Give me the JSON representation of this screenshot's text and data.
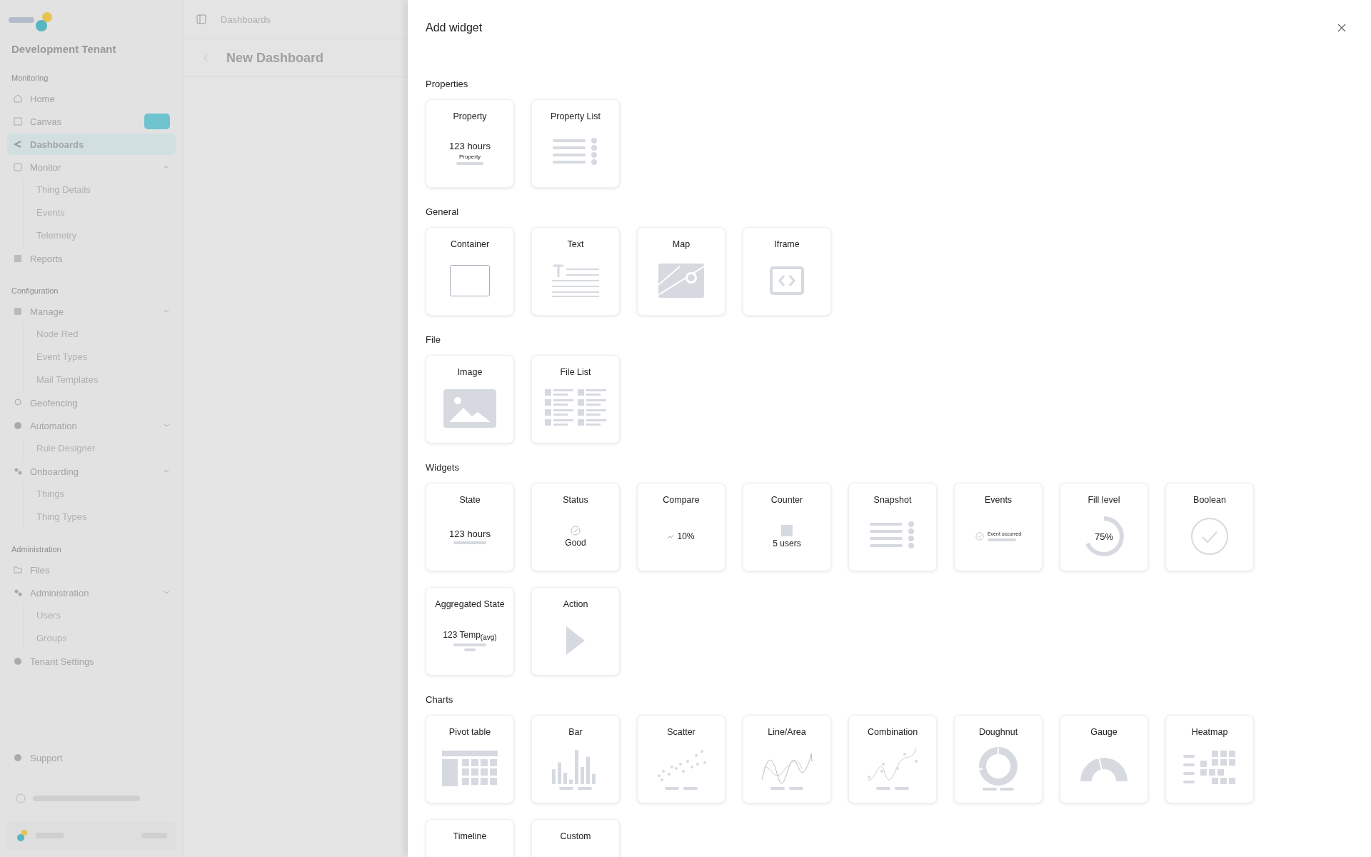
{
  "sidebar": {
    "tenant": "Development Tenant",
    "sections": [
      {
        "title": "Monitoring",
        "items": [
          {
            "label": "Home",
            "selected": false
          },
          {
            "label": "Canvas",
            "selected": false,
            "badge": true
          },
          {
            "label": "Dashboards",
            "selected": true
          },
          {
            "label": "Monitor",
            "selected": false,
            "expanded": true,
            "children": [
              {
                "label": "Thing Details"
              },
              {
                "label": "Events"
              },
              {
                "label": "Telemetry"
              }
            ]
          },
          {
            "label": "Reports",
            "selected": false
          }
        ]
      },
      {
        "title": "Configuration",
        "items": [
          {
            "label": "Manage",
            "selected": false,
            "expanded": true,
            "children": [
              {
                "label": "Node Red"
              },
              {
                "label": "Event Types"
              },
              {
                "label": "Mail Templates"
              }
            ]
          },
          {
            "label": "Geofencing",
            "selected": false
          },
          {
            "label": "Automation",
            "selected": false,
            "expanded": true,
            "children": [
              {
                "label": "Rule Designer"
              }
            ]
          },
          {
            "label": "Onboarding",
            "selected": false,
            "expanded": true,
            "children": [
              {
                "label": "Things"
              },
              {
                "label": "Thing Types"
              }
            ]
          }
        ]
      },
      {
        "title": "Administration",
        "items": [
          {
            "label": "Files",
            "selected": false
          },
          {
            "label": "Administration",
            "selected": false,
            "expanded": true,
            "children": [
              {
                "label": "Users"
              },
              {
                "label": "Groups"
              }
            ]
          },
          {
            "label": "Tenant Settings",
            "selected": false
          }
        ]
      }
    ],
    "support": "Support"
  },
  "topbar": {
    "breadcrumb": "Dashboards",
    "title": "New Dashboard"
  },
  "dialog": {
    "title": "Add widget",
    "sections": [
      {
        "title": "Properties",
        "items": [
          {
            "label": "Property",
            "kind": "property",
            "value": "123 hours",
            "caption": "Property"
          },
          {
            "label": "Property List",
            "kind": "list"
          }
        ]
      },
      {
        "title": "General",
        "items": [
          {
            "label": "Container",
            "kind": "container"
          },
          {
            "label": "Text",
            "kind": "text"
          },
          {
            "label": "Map",
            "kind": "map"
          },
          {
            "label": "Iframe",
            "kind": "iframe"
          }
        ]
      },
      {
        "title": "File",
        "items": [
          {
            "label": "Image",
            "kind": "image"
          },
          {
            "label": "File List",
            "kind": "filelist"
          }
        ]
      },
      {
        "title": "Widgets",
        "items": [
          {
            "label": "State",
            "kind": "state",
            "value": "123 hours"
          },
          {
            "label": "Status",
            "kind": "status",
            "value": "Good"
          },
          {
            "label": "Compare",
            "kind": "compare",
            "value": "10%"
          },
          {
            "label": "Counter",
            "kind": "counter",
            "value": "5 users"
          },
          {
            "label": "Snapshot",
            "kind": "list"
          },
          {
            "label": "Events",
            "kind": "events",
            "value": "Event occurred"
          },
          {
            "label": "Fill level",
            "kind": "fill",
            "value": "75%"
          },
          {
            "label": "Boolean",
            "kind": "boolean"
          },
          {
            "label": "Aggregated State",
            "kind": "aggregated",
            "value": "123 Temp$_{(avg)}$"
          },
          {
            "label": "Action",
            "kind": "action"
          }
        ]
      },
      {
        "title": "Charts",
        "items": [
          {
            "label": "Pivot table",
            "kind": "pivot"
          },
          {
            "label": "Bar",
            "kind": "bar"
          },
          {
            "label": "Scatter",
            "kind": "scatter"
          },
          {
            "label": "Line/Area",
            "kind": "line"
          },
          {
            "label": "Combination",
            "kind": "combination"
          },
          {
            "label": "Doughnut",
            "kind": "doughnut"
          },
          {
            "label": "Gauge",
            "kind": "gauge"
          },
          {
            "label": "Heatmap",
            "kind": "heatmap"
          },
          {
            "label": "Timeline",
            "kind": "none"
          },
          {
            "label": "Custom",
            "kind": "none"
          }
        ]
      }
    ]
  }
}
